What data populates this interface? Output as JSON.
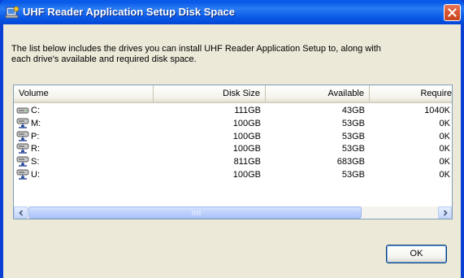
{
  "window": {
    "title": "UHF Reader Application Setup Disk Space"
  },
  "description": {
    "line1": "The list below includes the drives you can install UHF Reader Application Setup to, along with",
    "line2": "each drive's available and required disk space."
  },
  "table": {
    "columns": [
      "Volume",
      "Disk Size",
      "Available",
      "Require"
    ],
    "rows": [
      {
        "volume": "C:",
        "disk_size": "111GB",
        "available": "43GB",
        "required": "1040K",
        "icon": "local-drive-icon"
      },
      {
        "volume": "M:",
        "disk_size": "100GB",
        "available": "53GB",
        "required": "0K",
        "icon": "network-drive-icon"
      },
      {
        "volume": "P:",
        "disk_size": "100GB",
        "available": "53GB",
        "required": "0K",
        "icon": "network-drive-icon"
      },
      {
        "volume": "R:",
        "disk_size": "100GB",
        "available": "53GB",
        "required": "0K",
        "icon": "network-drive-icon"
      },
      {
        "volume": "S:",
        "disk_size": "811GB",
        "available": "683GB",
        "required": "0K",
        "icon": "network-drive-icon"
      },
      {
        "volume": "U:",
        "disk_size": "100GB",
        "available": "53GB",
        "required": "0K",
        "icon": "network-drive-icon"
      }
    ]
  },
  "buttons": {
    "ok_label": "OK"
  },
  "colors": {
    "titlebar": "#0a5ae9",
    "dialog_bg": "#ece9d8",
    "close": "#d9552f"
  }
}
